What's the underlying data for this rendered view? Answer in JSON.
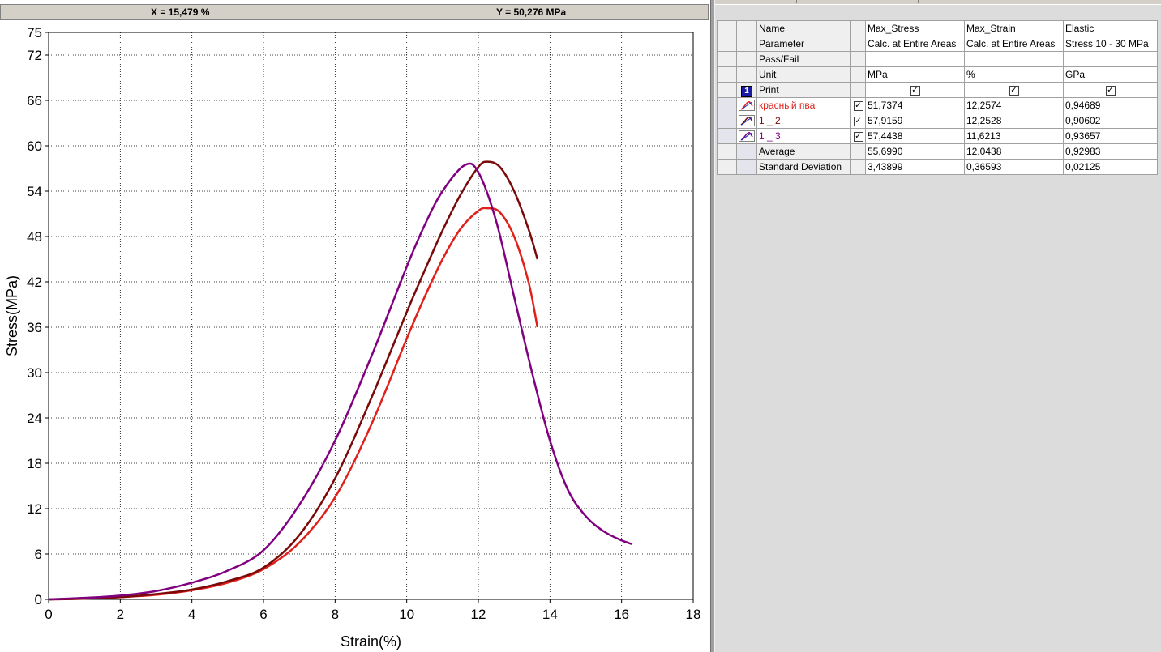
{
  "readout": {
    "x": "X = 15,479 %",
    "y": "Y = 50,276 MPa"
  },
  "chart_data": {
    "type": "line",
    "xlabel": "Strain(%)",
    "ylabel": "Stress(MPa)",
    "xlim": [
      0,
      18
    ],
    "ylim": [
      0,
      75
    ],
    "xticks": [
      0,
      2,
      4,
      6,
      8,
      10,
      12,
      14,
      16,
      18
    ],
    "yticks": [
      0,
      6,
      12,
      18,
      24,
      30,
      36,
      42,
      48,
      54,
      60,
      66,
      72,
      75
    ],
    "grid": true,
    "series": [
      {
        "name": "красный пва",
        "color": "#e0201a",
        "x": [
          0,
          1,
          2,
          3,
          4,
          5,
          6,
          7,
          8,
          9,
          10,
          10.5,
          11,
          11.5,
          12,
          12.26,
          12.6,
          13,
          13.4,
          13.65
        ],
        "y": [
          0,
          0.1,
          0.3,
          0.6,
          1.2,
          2.2,
          4.0,
          7.5,
          13.5,
          23,
          34.5,
          40,
          45,
          49,
          51.4,
          51.74,
          51.2,
          48,
          42,
          36
        ]
      },
      {
        "name": "1 _ 2",
        "color": "#7a0a0a",
        "x": [
          0,
          1,
          2,
          3,
          4,
          5,
          6,
          7,
          8,
          9,
          10,
          10.5,
          11,
          11.5,
          12,
          12.25,
          12.6,
          13,
          13.4,
          13.65
        ],
        "y": [
          0,
          0.1,
          0.3,
          0.7,
          1.3,
          2.4,
          4.2,
          8.5,
          16,
          26.5,
          38,
          43.5,
          48.8,
          53.5,
          57.2,
          57.9,
          57.2,
          54,
          49,
          45
        ]
      },
      {
        "name": "1 _ 3",
        "color": "#800080",
        "x": [
          0,
          1,
          2,
          3,
          4,
          5,
          6,
          7,
          8,
          9,
          10,
          10.5,
          11,
          11.62,
          12,
          12.5,
          13,
          13.5,
          14,
          14.5,
          15,
          15.5,
          16,
          16.3
        ],
        "y": [
          0,
          0.2,
          0.5,
          1.1,
          2.2,
          3.8,
          6.5,
          12.5,
          21,
          32,
          44,
          49.5,
          54,
          57.44,
          56.5,
          50,
          40,
          30,
          21,
          14.5,
          11,
          9,
          7.8,
          7.3
        ]
      }
    ]
  },
  "table": {
    "header_rows": [
      {
        "label": "Name",
        "cols": [
          "Max_Stress",
          "Max_Strain",
          "Elastic"
        ]
      },
      {
        "label": "Parameter",
        "cols": [
          "Calc. at Entire Areas",
          "Calc. at Entire Areas",
          "Stress 10 - 30 MPa"
        ]
      },
      {
        "label": "Pass/Fail",
        "cols": [
          "",
          "",
          ""
        ]
      },
      {
        "label": "Unit",
        "cols": [
          "MPa",
          "%",
          "GPa"
        ]
      },
      {
        "label": "Print",
        "cols": [
          "✓",
          "✓",
          "✓"
        ]
      }
    ],
    "print_badge": "1",
    "specimens": [
      {
        "name": "красный пва",
        "color": "#e0201a",
        "checked": "✓",
        "max_stress": "51,7374",
        "max_strain": "12,2574",
        "elastic": "0,94689"
      },
      {
        "name": "1 _ 2",
        "color": "#7a0a0a",
        "checked": "✓",
        "max_stress": "57,9159",
        "max_strain": "12,2528",
        "elastic": "0,90602"
      },
      {
        "name": "1 _ 3",
        "color": "#800080",
        "checked": "✓",
        "max_stress": "57,4438",
        "max_strain": "11,6213",
        "elastic": "0,93657"
      }
    ],
    "stats": [
      {
        "label": "Average",
        "max_stress": "55,6990",
        "max_strain": "12,0438",
        "elastic": "0,92983"
      },
      {
        "label": "Standard Deviation",
        "max_stress": "3,43899",
        "max_strain": "0,36593",
        "elastic": "0,02125"
      }
    ]
  }
}
